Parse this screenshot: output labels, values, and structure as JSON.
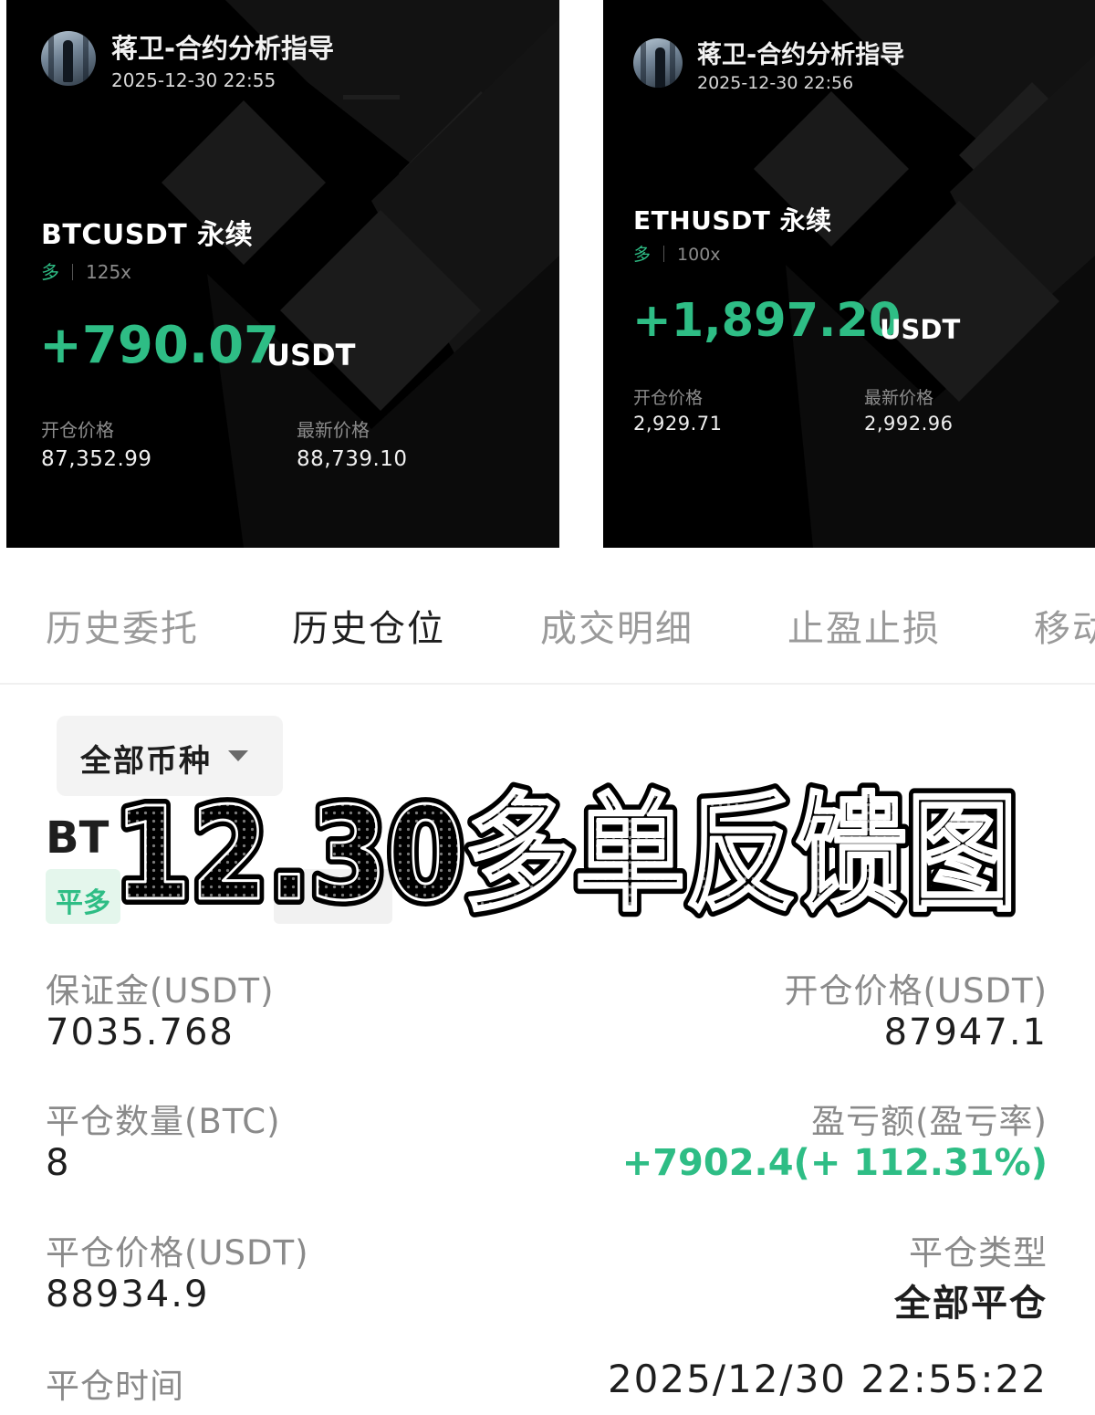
{
  "cards": [
    {
      "username": "蒋卫-合约分析指导",
      "time": "2025-12-30 22:55",
      "symbol": "BTCUSDT 永续",
      "direction": "多",
      "leverage": "125x",
      "pnl": "+790.07",
      "pnl_unit": "USDT",
      "open_price_label": "开仓价格",
      "open_price": "87,352.99",
      "last_price_label": "最新价格",
      "last_price": "88,739.10"
    },
    {
      "username": "蒋卫-合约分析指导",
      "time": "2025-12-30 22:56",
      "symbol": "ETHUSDT 永续",
      "direction": "多",
      "leverage": "100x",
      "pnl": "+1,897.20",
      "pnl_unit": "USDT",
      "open_price_label": "开仓价格",
      "open_price": "2,929.71",
      "last_price_label": "最新价格",
      "last_price": "2,992.96"
    }
  ],
  "tabs": [
    "历史委托",
    "历史仓位",
    "成交明细",
    "止盈止损",
    "移动"
  ],
  "active_tab": "历史仓位",
  "filter": {
    "label": "全部币种"
  },
  "position": {
    "symbol_visible": "BT",
    "tag": "平多"
  },
  "overlay_title": "12.30多单反馈图",
  "details": {
    "margin_label": "保证金(USDT)",
    "margin_value": "7035.768",
    "open_price_label": "开仓价格(USDT)",
    "open_price_value": "87947.1",
    "close_qty_label": "平仓数量(BTC)",
    "close_qty_value": "8",
    "pnl_label": "盈亏额(盈亏率)",
    "pnl_value": "+7902.4(+ 112.31%)",
    "close_price_label": "平仓价格(USDT)",
    "close_price_value": "88934.9",
    "close_type_label": "平仓类型",
    "close_type_value": "全部平仓",
    "close_time_label": "平仓时间",
    "close_time_value": "2025/12/30 22:55:22"
  },
  "colors": {
    "profit_green": "#2ebd85",
    "card_bg": "#000000",
    "text_dark": "#1e1e1e",
    "text_gray": "#8a8a8a"
  }
}
